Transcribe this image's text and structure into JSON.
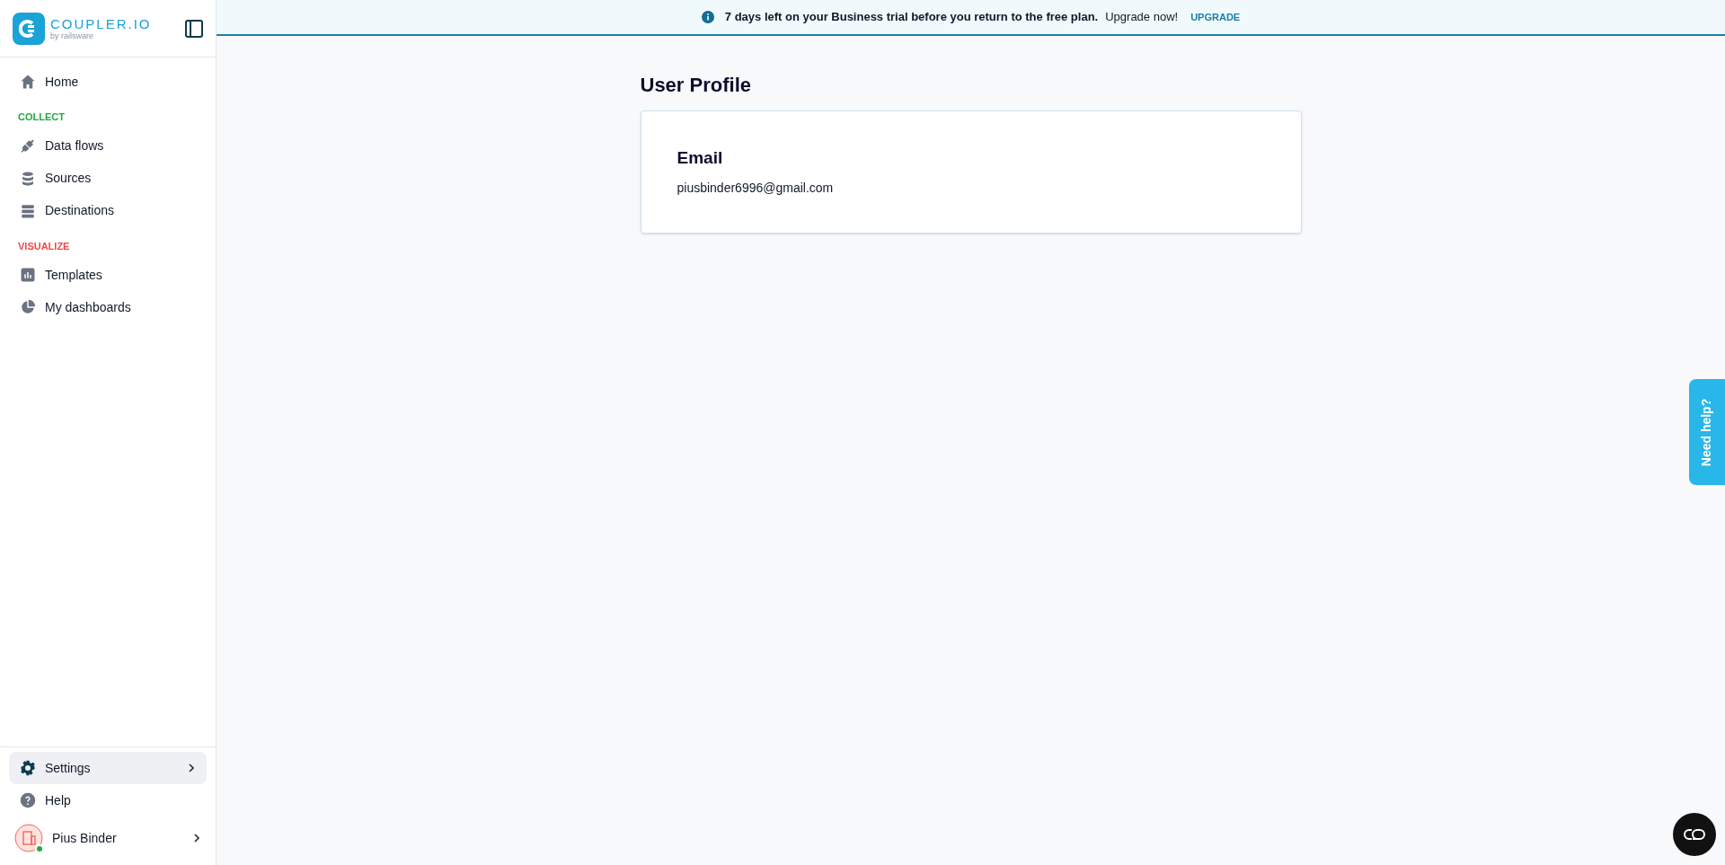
{
  "sidebar": {
    "logo": {
      "name": "COUPLER.IO",
      "byline": "by railsware"
    },
    "nav": [
      {
        "kind": "item",
        "label": "Home",
        "selected": false
      },
      {
        "kind": "section",
        "label": "COLLECT",
        "color": "#22a745"
      },
      {
        "kind": "item",
        "label": "Data flows",
        "selected": false
      },
      {
        "kind": "item",
        "label": "Sources",
        "selected": false
      },
      {
        "kind": "item",
        "label": "Destinations",
        "selected": false
      },
      {
        "kind": "section",
        "label": "VISUALIZE",
        "color": "#f04848"
      },
      {
        "kind": "item",
        "label": "Templates",
        "selected": false
      },
      {
        "kind": "item",
        "label": "My dashboards",
        "selected": false
      }
    ],
    "bottom": [
      {
        "label": "Settings",
        "selected": true
      },
      {
        "label": "Help",
        "selected": false
      }
    ],
    "user": {
      "name": "Pius Binder",
      "online": true
    }
  },
  "banner": {
    "message": "7 days left on your Business trial before you return to the free plan.",
    "hint": "Upgrade now!",
    "action": "UPGRADE"
  },
  "page": {
    "title": "User Profile",
    "card": {
      "label": "Email",
      "value": "piusbinder6996@gmail.com"
    }
  },
  "help_tab": {
    "label": "Need help?"
  }
}
